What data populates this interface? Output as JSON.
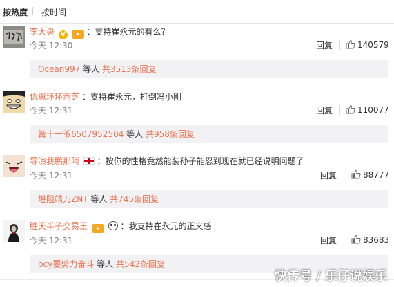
{
  "tabs": {
    "hot": "按热度",
    "time": "按时间"
  },
  "colors": {
    "accent": "#eb7350",
    "reply_bg": "#f2f2f5",
    "muted": "#808080"
  },
  "comments": [
    {
      "username": "李大央",
      "badges": [
        "v-badge-icon",
        "vip-badge-icon"
      ],
      "text": "：支持崔永元的有么？",
      "time": "今天 12:30",
      "reply_label": "回复",
      "likes": "140579",
      "replies": {
        "who": "Ocean997",
        "mid": " 等人 ",
        "count": "共3513条回复"
      }
    },
    {
      "username": "仇崽环环燕芝",
      "badges": [],
      "text": "：支持崔永元，打倒冯小刚",
      "time": "今天 12:31",
      "reply_label": "回复",
      "likes": "110077",
      "replies": {
        "who": "篝十一爷6507952504",
        "mid": " 等人 ",
        "count": "共958条回复"
      }
    },
    {
      "username": "导演我鹏那阿",
      "badges": [
        "flag-icon"
      ],
      "text": "：按你的性格竟然能装孙子能忍到现在就已经说明问题了",
      "time": "今天 12:31",
      "reply_label": "回复",
      "likes": "88777",
      "replies": {
        "who": "堪阻靖刀ZNT",
        "mid": " 等人 ",
        "count": "共745条回复"
      }
    },
    {
      "username": "胜天半子交易王",
      "badges": [
        "vip-badge-icon",
        "panda-icon"
      ],
      "text": "：我支持崔永元的正义感",
      "time": "今天 12:31",
      "reply_label": "回复",
      "likes": "83683",
      "replies": {
        "who": "bcy要努力奋斗",
        "mid": " 等人 ",
        "count": "共542条回复"
      }
    }
  ],
  "watermark": "快传号 / 乐仔说娱乐"
}
